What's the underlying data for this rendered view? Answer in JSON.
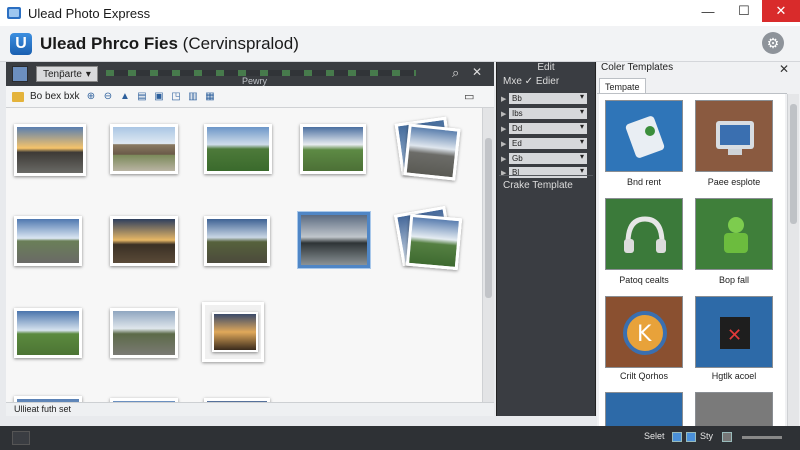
{
  "window": {
    "title": "Ulead Photo Express",
    "min": "—",
    "max": "☐",
    "close": "✕"
  },
  "header": {
    "logo_letter": "U",
    "app_name": "Ulead Phrco Fies",
    "subtitle": "(Cervinspralod)"
  },
  "browser": {
    "dropdown_label": "Tenp̈arte",
    "center_label": "Pewry",
    "folder_label": "Bo bex bxk",
    "status_text": "Ullieat futh set",
    "thumbnails": [
      {
        "name": "thumb-sunset-road",
        "selected": false
      },
      {
        "name": "thumb-chateau",
        "selected": false
      },
      {
        "name": "thumb-field",
        "selected": false
      },
      {
        "name": "thumb-clouds-road",
        "selected": false
      },
      {
        "name": "thumb-stacked-road",
        "selected": false
      },
      {
        "name": "thumb-highway",
        "selected": false
      },
      {
        "name": "thumb-sunrise",
        "selected": false
      },
      {
        "name": "thumb-meadow",
        "selected": false
      },
      {
        "name": "thumb-lake",
        "selected": true
      },
      {
        "name": "thumb-stacked-hills",
        "selected": false
      },
      {
        "name": "thumb-green-road",
        "selected": false
      },
      {
        "name": "thumb-bare-trees",
        "selected": false
      },
      {
        "name": "thumb-framed-sunset",
        "selected": false
      }
    ]
  },
  "edit_panel": {
    "title": "Edit",
    "subtitle": "Mxe ✓ Edier",
    "rows": [
      "Bb",
      "Ibs",
      "Dd",
      "Ed",
      "Gb",
      "Bl"
    ],
    "caption": "Crake Template"
  },
  "templates_panel": {
    "title": "Coler Templates",
    "tab": "Tempate",
    "tiles": [
      {
        "label": "Bnd rent",
        "bg": "#2f75b8"
      },
      {
        "label": "Paee esplote",
        "bg": "#8a5a40"
      },
      {
        "label": "Patoq cealts",
        "bg": "#3b7a3a"
      },
      {
        "label": "Bop fall",
        "bg": "#3f7f3a"
      },
      {
        "label": "Crilt Qorhos",
        "bg": "#8a5030"
      },
      {
        "label": "Hgtlk acoel",
        "bg": "#2d6aa8"
      }
    ]
  },
  "statusbar": {
    "select_label": "Selet",
    "style_label": "Sty"
  }
}
